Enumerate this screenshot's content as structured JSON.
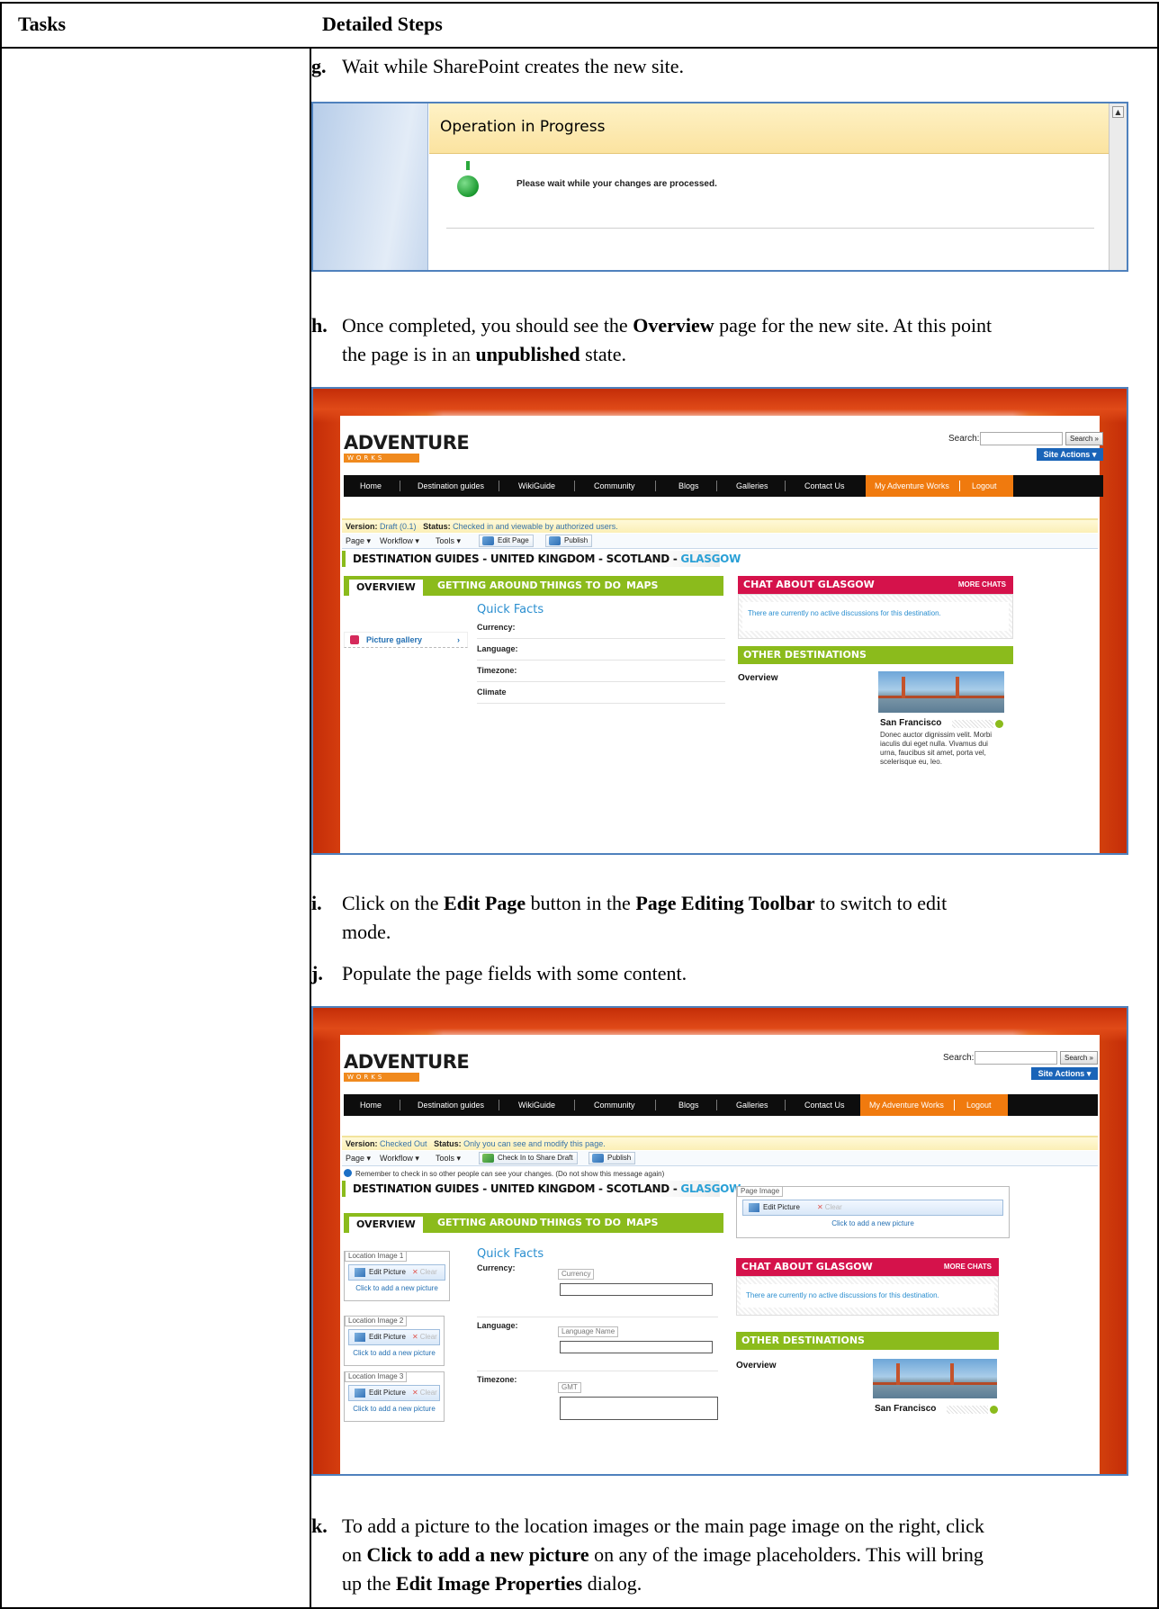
{
  "table": {
    "header_tasks": "Tasks",
    "header_steps": "Detailed Steps"
  },
  "steps": {
    "g": {
      "label": "g.",
      "text": "Wait while SharePoint creates the new site."
    },
    "h": {
      "label": "h.",
      "line1_a": "Once completed, you should see the ",
      "line1_b": "Overview",
      "line1_c": " page for the new site. At this point",
      "line2_a": "the page is in an ",
      "line2_b": "unpublished",
      "line2_c": " state."
    },
    "i": {
      "label": "i.",
      "line1_a": "Click on the ",
      "line1_b": "Edit Page",
      "line1_c": " button in the ",
      "line1_d": "Page Editing Toolbar",
      "line1_e": " to switch to edit",
      "line2": "mode."
    },
    "j": {
      "label": "j.",
      "text": "Populate the page fields with some content."
    },
    "k": {
      "label": "k.",
      "line1": "To add a picture to the location images or the main page image on the right, click",
      "line2_a": "on ",
      "line2_b": "Click to add a new picture",
      "line2_c": " on any of the image placeholders. This will bring",
      "line3_a": "up the ",
      "line3_b": "Edit Image Properties",
      "line3_c": " dialog."
    }
  },
  "operation": {
    "title": "Operation in Progress",
    "message": "Please wait while your changes are processed."
  },
  "site": {
    "logo": "ADVENTURE",
    "logo_sub": "WORKS",
    "search_label": "Search:",
    "search_button": "Search »",
    "site_actions": "Site Actions ▾",
    "nav": [
      "Home",
      "Destination guides",
      "WikiGuide",
      "Community",
      "Blogs",
      "Galleries",
      "Contact Us"
    ],
    "nav_right": [
      "My Adventure Works",
      "Logout"
    ],
    "toolbar": {
      "page": "Page ▾",
      "workflow": "Workflow ▾",
      "tools": "Tools ▾",
      "edit_page": "Edit Page",
      "check_in": "Check In to Share Draft",
      "publish": "Publish"
    },
    "breadcrumb": "DESTINATION GUIDES - UNITED KINGDOM - SCOTLAND - ",
    "breadcrumb_current": "GLASGOW",
    "tabs": [
      "OVERVIEW",
      "GETTING AROUND",
      "THINGS TO DO",
      "MAPS"
    ],
    "quick_facts": "Quick Facts",
    "facts": [
      "Currency:",
      "Language:",
      "Timezone:",
      "Climate"
    ],
    "picture_gallery": "Picture gallery",
    "chat_title": "CHAT ABOUT GLASGOW",
    "more_chats": "MORE CHATS",
    "chat_empty": "There are currently no active discussions for this destination.",
    "other_destinations": "OTHER DESTINATIONS",
    "overview": "Overview",
    "san_francisco": "San Francisco",
    "sf_desc": [
      "Donec auctor dignissim velit. Morbi",
      "iaculis dui eget nulla. Vivamus dui",
      "urna, faucibus sit amet, porta vel,",
      "scelerisque eu, leo."
    ]
  },
  "shot1": {
    "version_label": "Version:",
    "version_value": "Draft (0.1)",
    "status_label": "Status:",
    "status_value": "Checked in and viewable by authorized users."
  },
  "shot2": {
    "version_label": "Version:",
    "version_value": "Checked Out",
    "status_label": "Status:",
    "status_value": "Only you can see and modify this page.",
    "info": "Remember to check in so other people can see your changes.  (Do not show this message again)",
    "page_image": "Page Image",
    "edit_picture": "Edit Picture",
    "clear": "Clear",
    "click_add": "Click to add a new picture",
    "location_images": [
      "Location Image 1",
      "Location Image 2",
      "Location Image 3"
    ],
    "currency_field": "Currency",
    "language_field": "Language Name",
    "timezone_field": "GMT"
  },
  "colors": {
    "frame": "#4f81bd",
    "orange": "#f07a0e",
    "green": "#8bbb1c",
    "crimson": "#d5124b",
    "blue": "#1a64b8"
  }
}
